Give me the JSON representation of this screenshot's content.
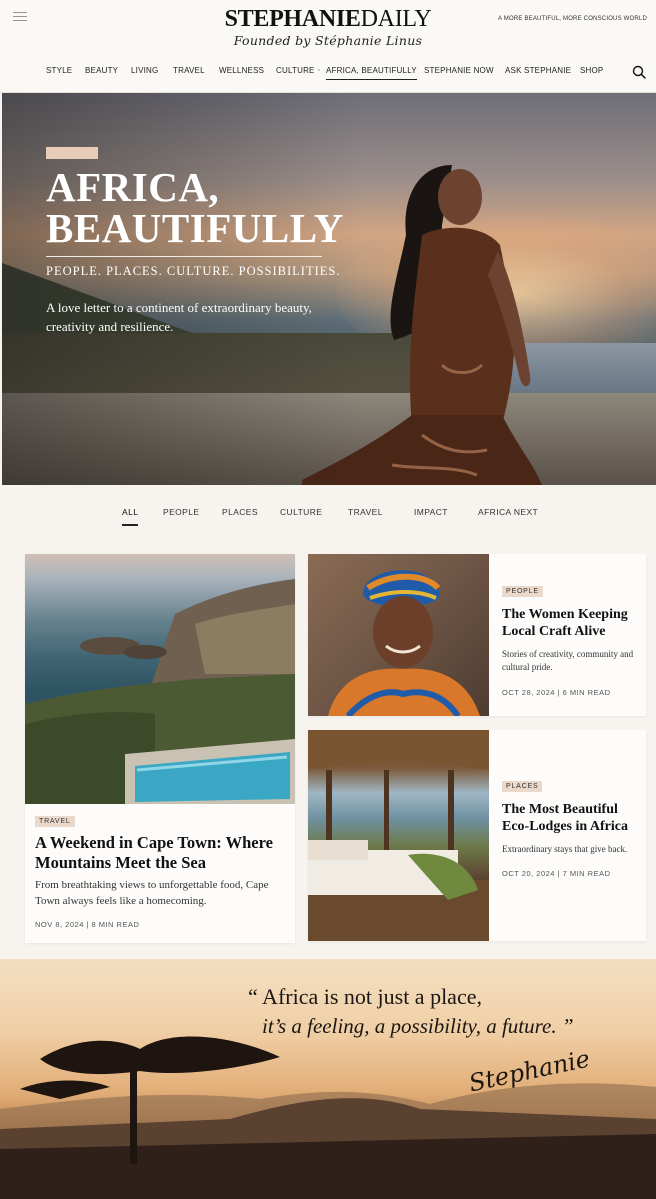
{
  "brand": {
    "logo_bold": "STEPHANIE",
    "logo_light": "DAILY",
    "tagline": "Founded by Stéphanie Linus",
    "slogan": "A MORE BEAUTIFUL, MORE CONSCIOUS WORLD"
  },
  "nav": {
    "items": [
      "STYLE",
      "BEAUTY",
      "LIVING",
      "TRAVEL",
      "WELLNESS",
      "CULTURE",
      "AFRICA, BEAUTIFULLY",
      "STEPHANIE NOW",
      "ASK STEPHANIE",
      "SHOP"
    ],
    "active": "AFRICA, BEAUTIFULLY"
  },
  "hero": {
    "title_line1": "AFRICA,",
    "title_line2": "BEAUTIFULLY",
    "subtitle": "PEOPLE. PLACES. CULTURE. POSSIBILITIES.",
    "description": "A love letter to a continent of extraordinary beauty, creativity and resilience."
  },
  "tabs": {
    "items": [
      "ALL",
      "PEOPLE",
      "PLACES",
      "CULTURE",
      "TRAVEL",
      "IMPACT",
      "AFRICA NEXT"
    ],
    "active": "ALL"
  },
  "articles": {
    "featured": {
      "tag": "TRAVEL",
      "title": "A Weekend in Cape Town: Where Mountains Meet the Sea",
      "description": "From breathtaking views to unforgettable food, Cape Town always feels like a homecoming.",
      "meta": "NOV 8, 2024   |   8 MIN READ"
    },
    "people": {
      "tag": "PEOPLE",
      "title": "The Women Keeping Local Craft Alive",
      "description": "Stories of creativity, community and cultural pride.",
      "meta": "OCT 28, 2024   |   6 MIN READ"
    },
    "places": {
      "tag": "PLACES",
      "title": "The Most Beautiful Eco-Lodges in Africa",
      "description": "Extraordinary stays that give back.",
      "meta": "OCT 20, 2024   |   7 MIN READ"
    }
  },
  "quote": {
    "line1": "“ Africa is not just a place,",
    "line2": "it’s a feeling, a possibility, a future. ”",
    "signature": "Stephanie"
  },
  "icons": {
    "menu": "hamburger-menu-icon",
    "search": "search-icon"
  }
}
